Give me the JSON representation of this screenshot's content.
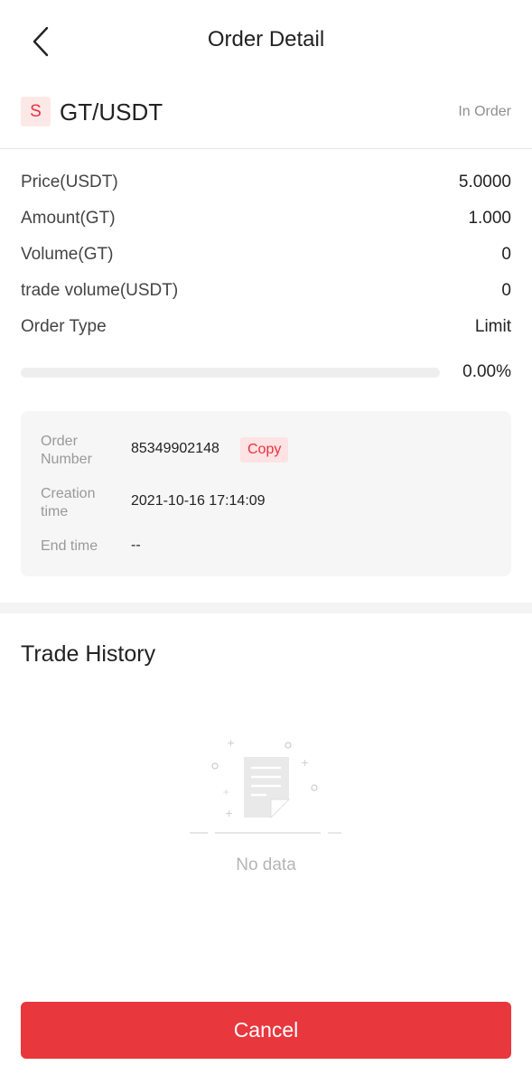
{
  "header": {
    "title": "Order Detail",
    "back_icon": "chevron-left-icon"
  },
  "pair": {
    "side": "S",
    "name": "GT/USDT",
    "status": "In Order"
  },
  "info": [
    {
      "label": "Price(USDT)",
      "value": "5.0000"
    },
    {
      "label": "Amount(GT)",
      "value": "1.000"
    },
    {
      "label": "Volume(GT)",
      "value": "0"
    },
    {
      "label": "trade volume(USDT)",
      "value": "0"
    },
    {
      "label": "Order Type",
      "value": "Limit"
    }
  ],
  "progress": {
    "fraction": 0.0,
    "label": "0.00%"
  },
  "details": {
    "order_number_label": "Order\nNumber",
    "order_number": "85349902148",
    "copy_label": "Copy",
    "creation_label": "Creation\ntime",
    "creation_time": "2021-10-16 17:14:09",
    "end_label": "End time",
    "end_time": "--"
  },
  "trade_history": {
    "title": "Trade History",
    "empty_text": "No data",
    "empty_icon": "document-icon"
  },
  "cancel_label": "Cancel",
  "colors": {
    "accent": "#e8323c",
    "badge_bg": "#fde8e8",
    "card_bg": "#f6f6f6"
  }
}
